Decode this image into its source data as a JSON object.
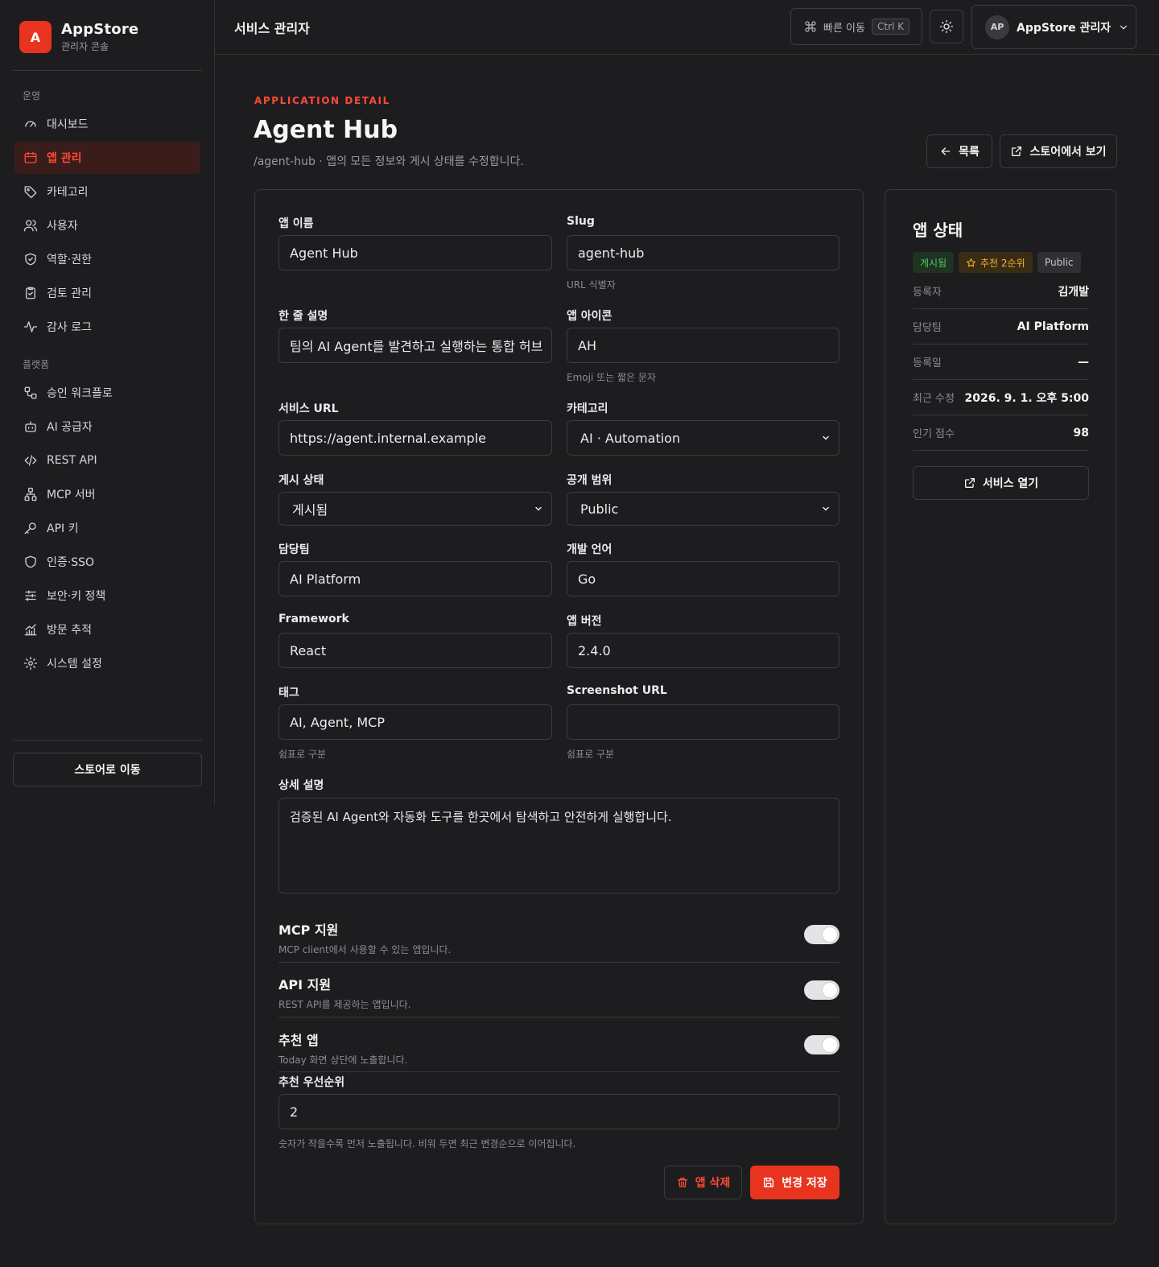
{
  "brand": {
    "logo_letter": "A",
    "title": "AppStore",
    "subtitle": "관리자 콘솔"
  },
  "sidebar": {
    "groups": [
      {
        "label": "운영"
      },
      {
        "label": "플랫폼"
      }
    ],
    "items": [
      {
        "label": "대시보드",
        "icon": "gauge-icon"
      },
      {
        "label": "앱 관리",
        "icon": "app-window-icon",
        "active": true
      },
      {
        "label": "카테고리",
        "icon": "tag-icon"
      },
      {
        "label": "사용자",
        "icon": "users-icon"
      },
      {
        "label": "역할·권한",
        "icon": "shield-check-icon"
      },
      {
        "label": "검토 관리",
        "icon": "clipboard-check-icon"
      },
      {
        "label": "감사 로그",
        "icon": "activity-icon"
      },
      {
        "label": "승인 워크플로",
        "icon": "workflow-icon"
      },
      {
        "label": "AI 공급자",
        "icon": "bot-icon"
      },
      {
        "label": "REST API",
        "icon": "code-icon"
      },
      {
        "label": "MCP 서버",
        "icon": "network-icon"
      },
      {
        "label": "API 키",
        "icon": "key-icon"
      },
      {
        "label": "인증·SSO",
        "icon": "shield-icon"
      },
      {
        "label": "보안·키 정책",
        "icon": "sliders-icon"
      },
      {
        "label": "방문 추적",
        "icon": "chart-icon"
      },
      {
        "label": "시스템 설정",
        "icon": "gear-icon"
      }
    ],
    "store_button": "스토어로 이동"
  },
  "topbar": {
    "title": "서비스 관리자",
    "quick_nav": "빠른 이동",
    "shortcut": "Ctrl K",
    "user_initials": "AP",
    "user_name": "AppStore 관리자"
  },
  "header": {
    "eyebrow": "APPLICATION DETAIL",
    "title": "Agent Hub",
    "subtitle": "/agent-hub · 앱의 모든 정보와 게시 상태를 수정합니다.",
    "back_button": "목록",
    "store_view_button": "스토어에서 보기"
  },
  "form": {
    "app_name": {
      "label": "앱 이름",
      "value": "Agent Hub"
    },
    "slug": {
      "label": "Slug",
      "value": "agent-hub",
      "help": "URL 식별자"
    },
    "short_desc": {
      "label": "한 줄 설명",
      "value": "팀의 AI Agent를 발견하고 실행하는 통합 허브"
    },
    "app_icon": {
      "label": "앱 아이콘",
      "value": "AH",
      "help": "Emoji 또는 짧은 문자"
    },
    "service_url": {
      "label": "서비스 URL",
      "value": "https://agent.internal.example"
    },
    "category": {
      "label": "카테고리",
      "value": "AI · Automation"
    },
    "publish_status": {
      "label": "게시 상태",
      "value": "게시됨"
    },
    "visibility": {
      "label": "공개 범위",
      "value": "Public"
    },
    "team": {
      "label": "담당팀",
      "value": "AI Platform"
    },
    "language": {
      "label": "개발 언어",
      "value": "Go"
    },
    "framework": {
      "label": "Framework",
      "value": "React"
    },
    "version": {
      "label": "앱 버전",
      "value": "2.4.0"
    },
    "tags": {
      "label": "태그",
      "value": "AI, Agent, MCP",
      "help": "쉼표로 구분"
    },
    "screenshot_url": {
      "label": "Screenshot URL",
      "value": "",
      "help": "쉼표로 구분"
    },
    "detail_desc": {
      "label": "상세 설명",
      "value": "검증된 AI Agent와 자동화 도구를 한곳에서 탐색하고 안전하게 실행합니다."
    },
    "toggles": [
      {
        "title": "MCP 지원",
        "desc": "MCP client에서 사용할 수 있는 앱입니다.",
        "on": true
      },
      {
        "title": "API 지원",
        "desc": "REST API를 제공하는 앱입니다.",
        "on": true
      },
      {
        "title": "추천 앱",
        "desc": "Today 화면 상단에 노출합니다.",
        "on": true
      }
    ],
    "priority": {
      "label": "추천 우선순위",
      "value": "2",
      "help": "숫자가 작을수록 먼저 노출됩니다. 비워 두면 최근 변경순으로 이어집니다."
    },
    "delete_button": "앱 삭제",
    "save_button": "변경 저장"
  },
  "status": {
    "title": "앱 상태",
    "badges": {
      "published": "게시됨",
      "featured": "추천 2순위",
      "visibility": "Public"
    },
    "rows": [
      {
        "key": "등록자",
        "value": "김개발"
      },
      {
        "key": "담당팀",
        "value": "AI Platform"
      },
      {
        "key": "등록일",
        "value": "—"
      },
      {
        "key": "최근 수정",
        "value": "2026. 9. 1. 오후 5:00"
      },
      {
        "key": "인기 점수",
        "value": "98"
      }
    ],
    "open_button": "서비스 열기"
  },
  "colors": {
    "accent": "#e8331f",
    "accent_text": "#ff4a35",
    "background": "#1d1d1f",
    "border": "#3c3c40",
    "success": "#4fd163",
    "warning": "#f5b335"
  }
}
